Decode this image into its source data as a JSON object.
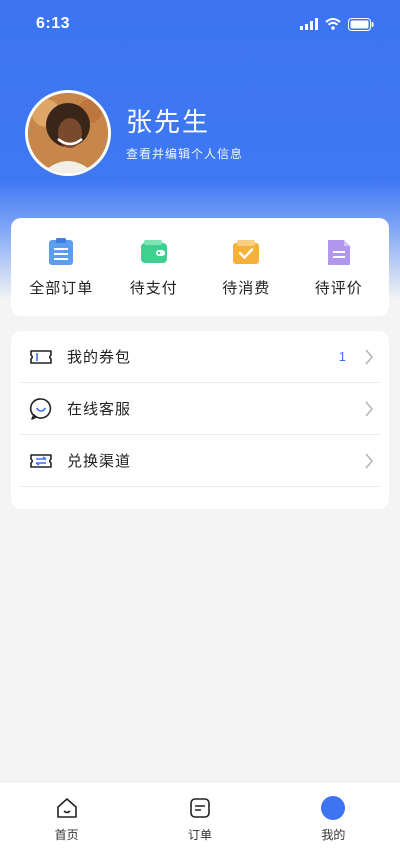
{
  "status_bar": {
    "time": "6:13"
  },
  "profile": {
    "name": "张先生",
    "subtitle": "查看并编辑个人信息"
  },
  "orders": [
    {
      "label": "全部订单",
      "icon": "all-orders-icon",
      "color": "#5b9ef0"
    },
    {
      "label": "待支付",
      "icon": "wallet-icon",
      "color": "#3fcf8e"
    },
    {
      "label": "待消费",
      "icon": "check-box-icon",
      "color": "#f5b13a"
    },
    {
      "label": "待评价",
      "icon": "review-icon",
      "color": "#b196f0"
    }
  ],
  "menu": [
    {
      "label": "我的券包",
      "badge": "1",
      "icon": "ticket-icon"
    },
    {
      "label": "在线客服",
      "badge": "",
      "icon": "customer-service-icon"
    },
    {
      "label": "兑换渠道",
      "badge": "",
      "icon": "exchange-icon"
    }
  ],
  "tabs": [
    {
      "label": "首页",
      "icon": "home-icon"
    },
    {
      "label": "订单",
      "icon": "order-icon"
    },
    {
      "label": "我的",
      "icon": "profile-icon"
    }
  ],
  "colors": {
    "brand": "#3c74f2",
    "background": "#f4f4f4"
  }
}
